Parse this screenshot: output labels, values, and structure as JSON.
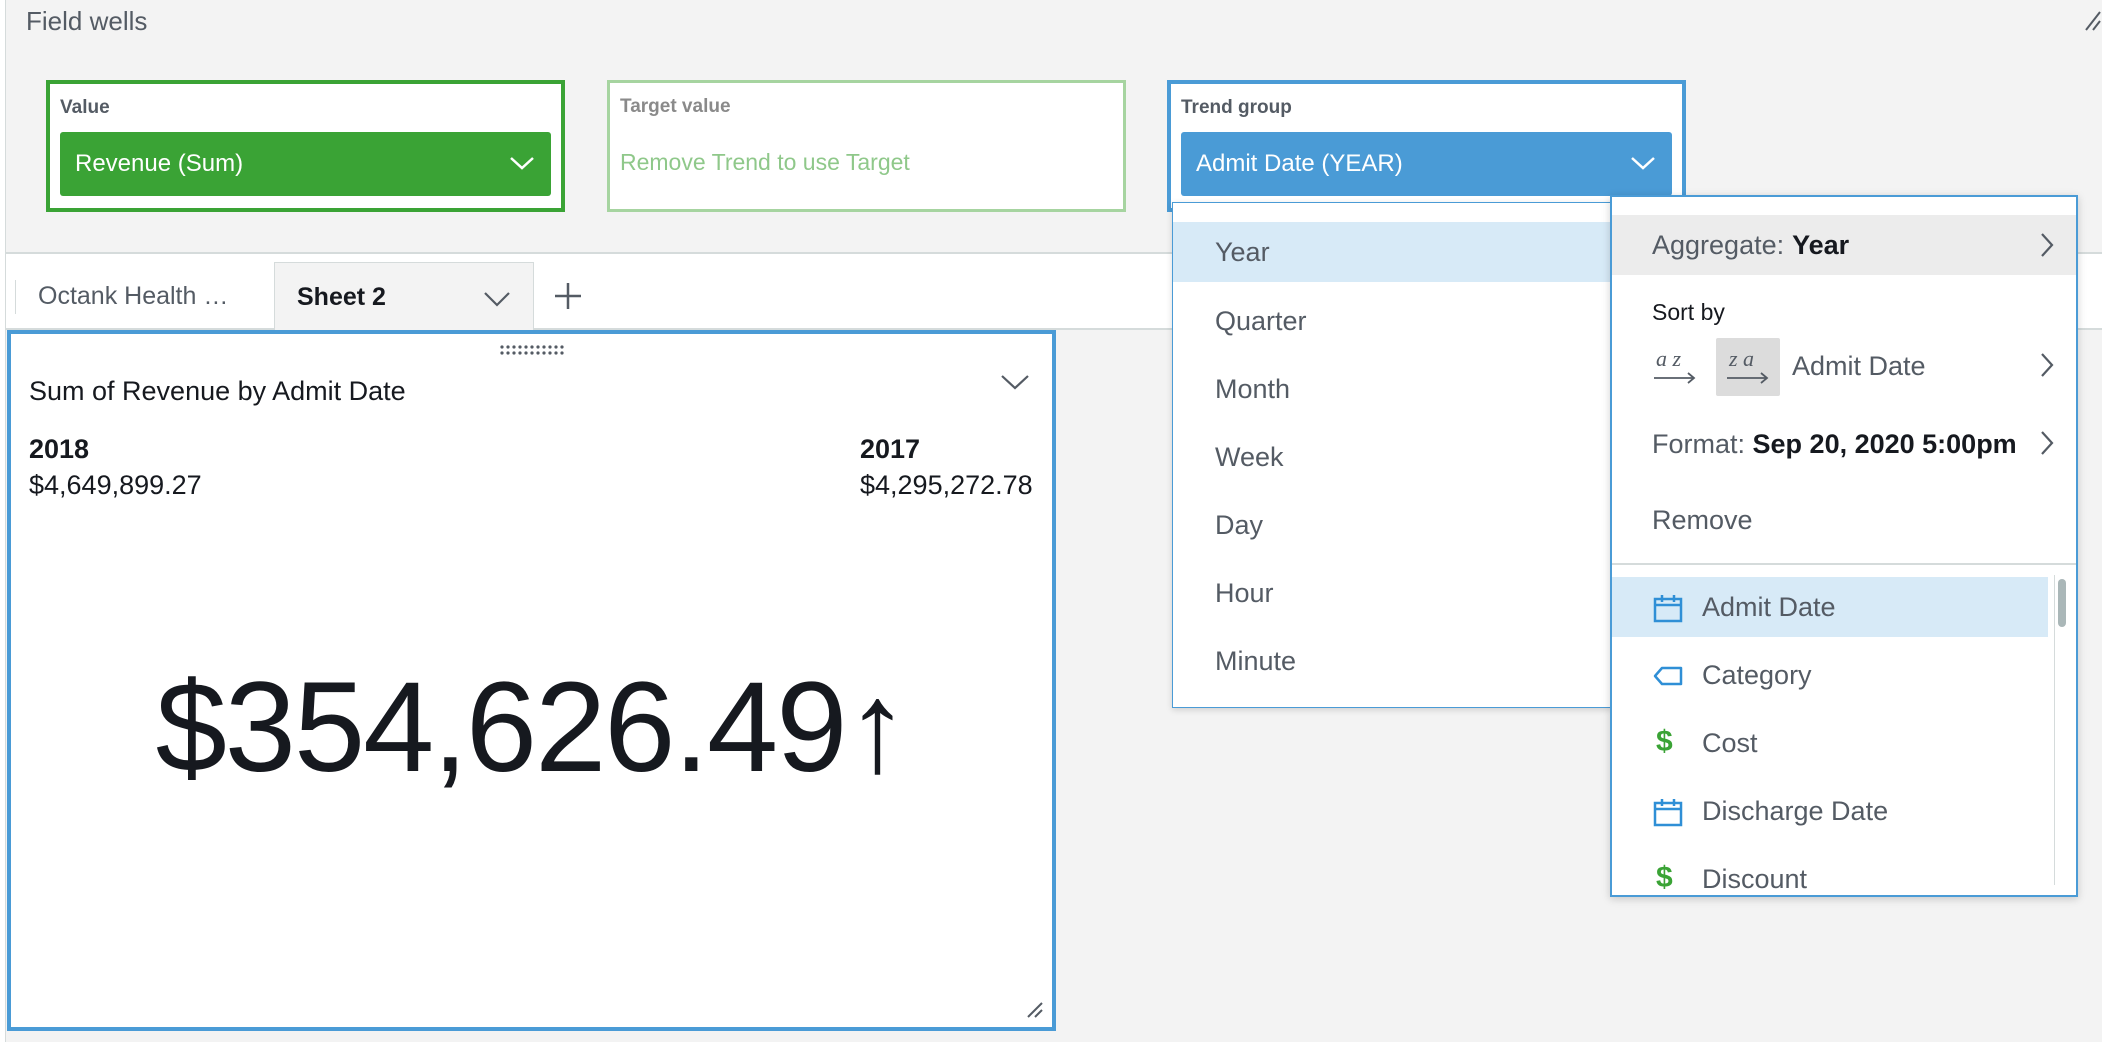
{
  "field_wells": {
    "title": "Field wells",
    "value": {
      "label": "Value",
      "field": "Revenue (Sum)",
      "color": "#3aa335"
    },
    "target": {
      "label": "Target value",
      "placeholder": "Remove Trend to use Target"
    },
    "trend": {
      "label": "Trend group",
      "field": "Admit Date (YEAR)",
      "color": "#4a9bd6"
    }
  },
  "tabs": [
    {
      "label": "Octank Health …"
    },
    {
      "label": "Sheet 2"
    }
  ],
  "visual": {
    "title": "Sum of Revenue by Admit Date",
    "current": {
      "year": "2018",
      "value": "$4,649,899.27"
    },
    "previous": {
      "year": "2017",
      "value": "$4,295,272.78"
    },
    "kpi": "$354,626.49↑"
  },
  "granularity_menu": {
    "options": [
      "Year",
      "Quarter",
      "Month",
      "Week",
      "Day",
      "Hour",
      "Minute"
    ],
    "selected": "Year"
  },
  "field_menu": {
    "aggregate_label": "Aggregate:",
    "aggregate_value": "Year",
    "sort_by_label": "Sort by",
    "sort_az_icon": "a z",
    "sort_za_icon": "z a",
    "sort_field": "Admit Date",
    "format_label": "Format:",
    "format_value": "Sep 20, 2020 5:00pm",
    "remove_label": "Remove",
    "fields": [
      {
        "name": "Admit Date",
        "icon": "calendar-icon"
      },
      {
        "name": "Category",
        "icon": "tag-icon"
      },
      {
        "name": "Cost",
        "icon": "dollar-icon"
      },
      {
        "name": "Discharge Date",
        "icon": "calendar-icon"
      },
      {
        "name": "Discount",
        "icon": "dollar-icon"
      }
    ]
  }
}
